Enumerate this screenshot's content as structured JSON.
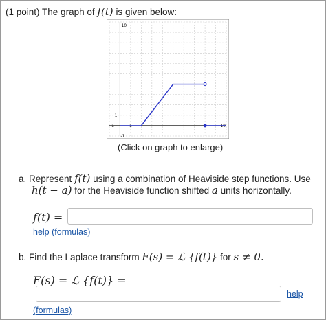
{
  "header": {
    "points": "(1 point)",
    "prompt": "The graph of",
    "fn": "f(t)",
    "suffix": "is given below:"
  },
  "graph": {
    "caption": "(Click on graph to enlarge)",
    "tick_labels": {
      "y_top": "10",
      "y_one": "1",
      "y_neg": "-1",
      "x_neg": "-1",
      "x_one": "1",
      "x_right": "10"
    },
    "line_color": "#2a35c9",
    "chart_data": {
      "type": "line",
      "xlim": [
        -1,
        10
      ],
      "ylim": [
        -1,
        10
      ],
      "grid": true,
      "series": [
        {
          "values": [
            [
              0,
              0
            ],
            [
              2,
              0
            ],
            [
              5,
              4
            ],
            [
              8,
              4
            ]
          ],
          "end_marker": "open-circle"
        },
        {
          "values": [
            [
              8,
              0
            ],
            [
              10,
              0
            ]
          ],
          "start_marker": "filled-circle"
        }
      ]
    }
  },
  "part_a": {
    "text1": "a. Represent",
    "fn": "f(t)",
    "text2": "using a combination of Heaviside step functions. Use",
    "h": "h(t − a)",
    "text3": "for the Heaviside function shifted",
    "a": "a",
    "text4": "units horizontally.",
    "label": "f(t) =",
    "input_value": "",
    "help": "help (formulas)"
  },
  "part_b": {
    "text1": "b. Find the Laplace transform",
    "expr": "F(s) = ℒ {f(t)}",
    "text2": "for",
    "cond": "s ≠ 0.",
    "label": "F(s) = ℒ {f(t)} =",
    "input_value": "",
    "help": "help",
    "help2": "(formulas)"
  }
}
